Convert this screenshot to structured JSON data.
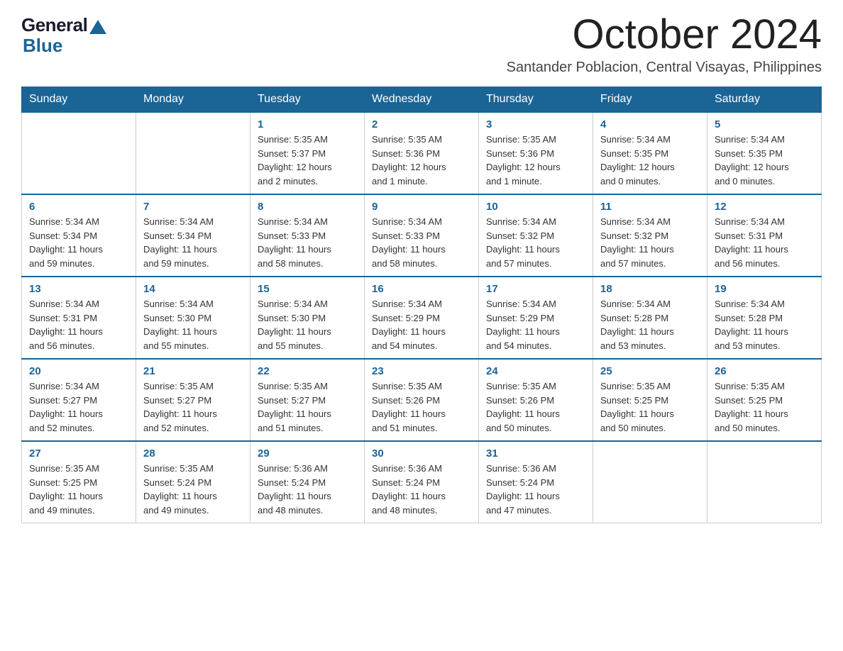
{
  "header": {
    "logo_general": "General",
    "logo_blue": "Blue",
    "month_title": "October 2024",
    "location": "Santander Poblacion, Central Visayas, Philippines"
  },
  "days_of_week": [
    "Sunday",
    "Monday",
    "Tuesday",
    "Wednesday",
    "Thursday",
    "Friday",
    "Saturday"
  ],
  "weeks": [
    [
      {
        "day": "",
        "info": ""
      },
      {
        "day": "",
        "info": ""
      },
      {
        "day": "1",
        "info": "Sunrise: 5:35 AM\nSunset: 5:37 PM\nDaylight: 12 hours\nand 2 minutes."
      },
      {
        "day": "2",
        "info": "Sunrise: 5:35 AM\nSunset: 5:36 PM\nDaylight: 12 hours\nand 1 minute."
      },
      {
        "day": "3",
        "info": "Sunrise: 5:35 AM\nSunset: 5:36 PM\nDaylight: 12 hours\nand 1 minute."
      },
      {
        "day": "4",
        "info": "Sunrise: 5:34 AM\nSunset: 5:35 PM\nDaylight: 12 hours\nand 0 minutes."
      },
      {
        "day": "5",
        "info": "Sunrise: 5:34 AM\nSunset: 5:35 PM\nDaylight: 12 hours\nand 0 minutes."
      }
    ],
    [
      {
        "day": "6",
        "info": "Sunrise: 5:34 AM\nSunset: 5:34 PM\nDaylight: 11 hours\nand 59 minutes."
      },
      {
        "day": "7",
        "info": "Sunrise: 5:34 AM\nSunset: 5:34 PM\nDaylight: 11 hours\nand 59 minutes."
      },
      {
        "day": "8",
        "info": "Sunrise: 5:34 AM\nSunset: 5:33 PM\nDaylight: 11 hours\nand 58 minutes."
      },
      {
        "day": "9",
        "info": "Sunrise: 5:34 AM\nSunset: 5:33 PM\nDaylight: 11 hours\nand 58 minutes."
      },
      {
        "day": "10",
        "info": "Sunrise: 5:34 AM\nSunset: 5:32 PM\nDaylight: 11 hours\nand 57 minutes."
      },
      {
        "day": "11",
        "info": "Sunrise: 5:34 AM\nSunset: 5:32 PM\nDaylight: 11 hours\nand 57 minutes."
      },
      {
        "day": "12",
        "info": "Sunrise: 5:34 AM\nSunset: 5:31 PM\nDaylight: 11 hours\nand 56 minutes."
      }
    ],
    [
      {
        "day": "13",
        "info": "Sunrise: 5:34 AM\nSunset: 5:31 PM\nDaylight: 11 hours\nand 56 minutes."
      },
      {
        "day": "14",
        "info": "Sunrise: 5:34 AM\nSunset: 5:30 PM\nDaylight: 11 hours\nand 55 minutes."
      },
      {
        "day": "15",
        "info": "Sunrise: 5:34 AM\nSunset: 5:30 PM\nDaylight: 11 hours\nand 55 minutes."
      },
      {
        "day": "16",
        "info": "Sunrise: 5:34 AM\nSunset: 5:29 PM\nDaylight: 11 hours\nand 54 minutes."
      },
      {
        "day": "17",
        "info": "Sunrise: 5:34 AM\nSunset: 5:29 PM\nDaylight: 11 hours\nand 54 minutes."
      },
      {
        "day": "18",
        "info": "Sunrise: 5:34 AM\nSunset: 5:28 PM\nDaylight: 11 hours\nand 53 minutes."
      },
      {
        "day": "19",
        "info": "Sunrise: 5:34 AM\nSunset: 5:28 PM\nDaylight: 11 hours\nand 53 minutes."
      }
    ],
    [
      {
        "day": "20",
        "info": "Sunrise: 5:34 AM\nSunset: 5:27 PM\nDaylight: 11 hours\nand 52 minutes."
      },
      {
        "day": "21",
        "info": "Sunrise: 5:35 AM\nSunset: 5:27 PM\nDaylight: 11 hours\nand 52 minutes."
      },
      {
        "day": "22",
        "info": "Sunrise: 5:35 AM\nSunset: 5:27 PM\nDaylight: 11 hours\nand 51 minutes."
      },
      {
        "day": "23",
        "info": "Sunrise: 5:35 AM\nSunset: 5:26 PM\nDaylight: 11 hours\nand 51 minutes."
      },
      {
        "day": "24",
        "info": "Sunrise: 5:35 AM\nSunset: 5:26 PM\nDaylight: 11 hours\nand 50 minutes."
      },
      {
        "day": "25",
        "info": "Sunrise: 5:35 AM\nSunset: 5:25 PM\nDaylight: 11 hours\nand 50 minutes."
      },
      {
        "day": "26",
        "info": "Sunrise: 5:35 AM\nSunset: 5:25 PM\nDaylight: 11 hours\nand 50 minutes."
      }
    ],
    [
      {
        "day": "27",
        "info": "Sunrise: 5:35 AM\nSunset: 5:25 PM\nDaylight: 11 hours\nand 49 minutes."
      },
      {
        "day": "28",
        "info": "Sunrise: 5:35 AM\nSunset: 5:24 PM\nDaylight: 11 hours\nand 49 minutes."
      },
      {
        "day": "29",
        "info": "Sunrise: 5:36 AM\nSunset: 5:24 PM\nDaylight: 11 hours\nand 48 minutes."
      },
      {
        "day": "30",
        "info": "Sunrise: 5:36 AM\nSunset: 5:24 PM\nDaylight: 11 hours\nand 48 minutes."
      },
      {
        "day": "31",
        "info": "Sunrise: 5:36 AM\nSunset: 5:24 PM\nDaylight: 11 hours\nand 47 minutes."
      },
      {
        "day": "",
        "info": ""
      },
      {
        "day": "",
        "info": ""
      }
    ]
  ]
}
